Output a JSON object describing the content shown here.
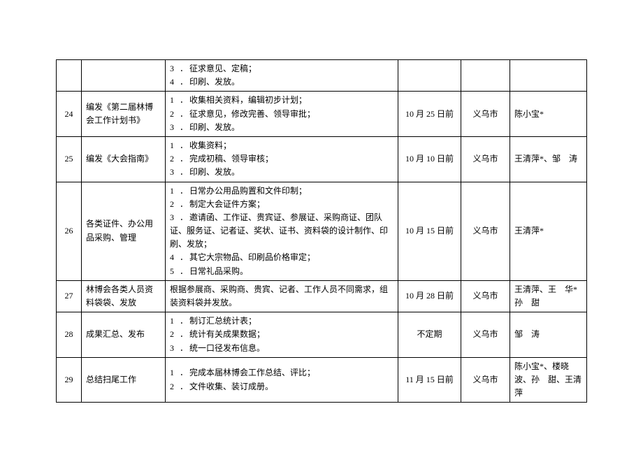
{
  "rows": [
    {
      "no": "",
      "task": "",
      "steps": [
        {
          "n": "3",
          "t": "征求意见、定稿；"
        },
        {
          "n": "4",
          "t": "印刷、发放。"
        }
      ],
      "date": "",
      "city": "",
      "people": ""
    },
    {
      "no": "24",
      "task": "编发《第二届林博会工作计划书》",
      "steps": [
        {
          "n": "1",
          "t": "收集相关资料，编辑初步计划；"
        },
        {
          "n": "2",
          "t": "征求意见，修改完善、领导审批；"
        },
        {
          "n": "3",
          "t": "印刷、发放。"
        }
      ],
      "date": "10 月 25 日前",
      "city": "义乌市",
      "people": "陈小宝*"
    },
    {
      "no": "25",
      "task": "编发《大会指南》",
      "steps": [
        {
          "n": "1",
          "t": "收集资料；"
        },
        {
          "n": "2",
          "t": "完成初稿、领导审核；"
        },
        {
          "n": "3",
          "t": "印刷、发放。"
        }
      ],
      "date": "10 月 10 日前",
      "city": "义乌市",
      "people": "王清萍*、邹　涛"
    },
    {
      "no": "26",
      "task": "各类证件、办公用品采购、管理",
      "steps": [
        {
          "n": "1",
          "t": "日常办公用品购置和文件印制；"
        },
        {
          "n": "2",
          "t": "制定大会证件方案；"
        },
        {
          "n": "3",
          "t": "邀请函、工作证、贵宾证、参展证、采购商证、团队证、服务证、记者证、奖状、证书、资料袋的设计制作、印刷、发放；"
        },
        {
          "n": "4",
          "t": "其它大宗物品、印刷品价格审定；"
        },
        {
          "n": "5",
          "t": "日常礼品采购。"
        }
      ],
      "date": "10 月 15 日前",
      "city": "义乌市",
      "people": "王清萍*"
    },
    {
      "no": "27",
      "task": "林博会各类人员资料袋袋、发放",
      "steps_plain": "根据参展商、采购商、贵宾、记者、工作人员不同需求，组装资料袋并发放。",
      "date": "10 月 28 日前",
      "city": "义乌市",
      "people": "王清萍、王　华*孙　甜"
    },
    {
      "no": "28",
      "task": "成果汇总、发布",
      "steps": [
        {
          "n": "1",
          "t": "制订汇总统计表；"
        },
        {
          "n": "2",
          "t": "统计有关成果数据；"
        },
        {
          "n": "3",
          "t": "统一口径发布信息。"
        }
      ],
      "date": "不定期",
      "city": "义乌市",
      "people": "邹　涛"
    },
    {
      "no": "29",
      "task": "总结扫尾工作",
      "steps": [
        {
          "n": "1",
          "t": "完成本届林博会工作总结、评比；"
        },
        {
          "n": "2",
          "t": "文件收集、装订成册。"
        }
      ],
      "date": "11 月 15 日前",
      "city": "义乌市",
      "people": "陈小宝*、楼晓波、孙　甜、王清萍"
    }
  ]
}
